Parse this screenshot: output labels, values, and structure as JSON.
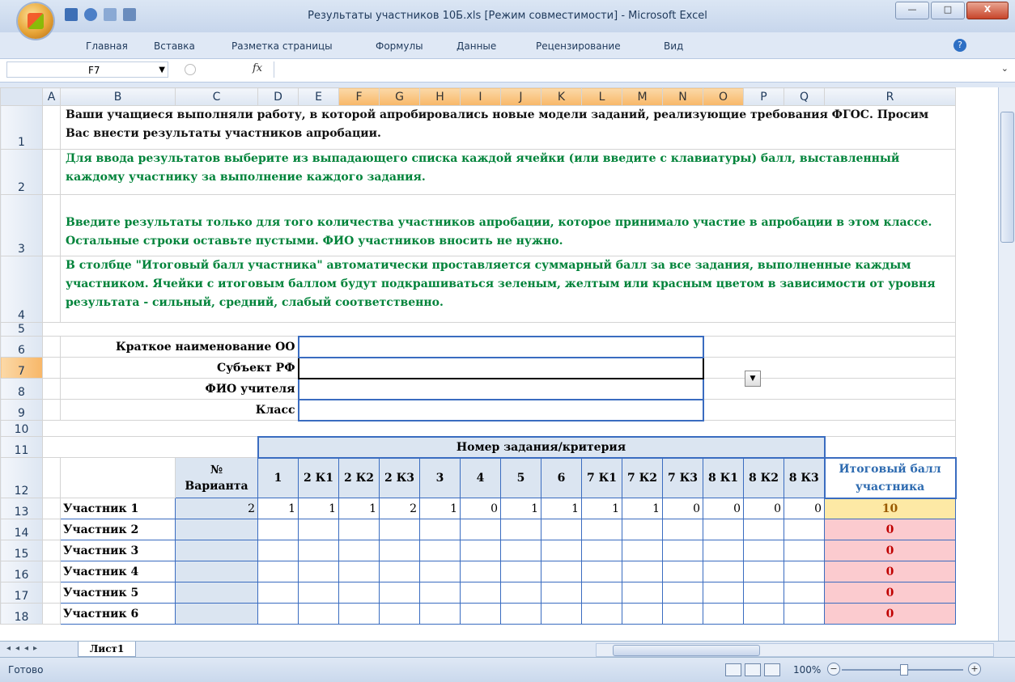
{
  "window": {
    "title": "Результаты участников 10Б.xls  [Режим совместимости] - Microsoft Excel",
    "buttons": {
      "minimize": "—",
      "maximize": "□",
      "close": "X"
    }
  },
  "ribbon": {
    "tabs": [
      "Главная",
      "Вставка",
      "Разметка страницы",
      "Формулы",
      "Данные",
      "Рецензирование",
      "Вид"
    ],
    "help_label": "?"
  },
  "formula_bar": {
    "name_box": "F7",
    "fx_label": "fx",
    "value": ""
  },
  "columns": [
    "A",
    "B",
    "C",
    "D",
    "E",
    "F",
    "G",
    "H",
    "I",
    "J",
    "K",
    "L",
    "M",
    "N",
    "O",
    "P",
    "Q",
    "R"
  ],
  "rows": [
    "1",
    "2",
    "3",
    "4",
    "5",
    "6",
    "7",
    "8",
    "9",
    "10",
    "11",
    "12",
    "13",
    "14",
    "15",
    "16",
    "17",
    "18"
  ],
  "instructions": {
    "r1": "Ваши учащиеся выполняли работу, в которой апробировались новые модели заданий, реализующие требования ФГОС. Просим Вас внести результаты участников апробации.",
    "r2": "Для ввода результатов выберите из выпадающего списка каждой ячейки (или введите с клавиатуры) балл, выставленный каждому участнику за выполнение каждого задания.",
    "r3": "Введите результаты только для того количества участников апробации, которое принимало участие в апробации в этом классе. Остальные строки оставьте пустыми.   ФИО участников вносить не нужно.",
    "r4": "В столбце \"Итоговый балл участника\" автоматически проставляется суммарный балл за все задания, выполненные каждым участником. Ячейки с итоговым баллом будут подкрашиваться зеленым, желтым или красным цветом в зависимости от уровня результата - сильный, средний, слабый соответственно."
  },
  "form": {
    "oo_label": "Краткое наименование ОО",
    "region_label": "Субъект РФ",
    "teacher_label": "ФИО учителя",
    "class_label": "Класс"
  },
  "table": {
    "task_header": "Номер задания/критерия",
    "variant_header": "№ Варианта",
    "total_header": "Итоговый балл участника",
    "task_columns": [
      "1",
      "2 К1",
      "2 К2",
      "2 К3",
      "3",
      "4",
      "5",
      "6",
      "7 К1",
      "7 К2",
      "7 К3",
      "8 К1",
      "8 К2",
      "8 К3"
    ],
    "participants": [
      {
        "name": "Участник 1",
        "variant": "2",
        "scores": [
          "1",
          "1",
          "1",
          "2",
          "1",
          "0",
          "1",
          "1",
          "1",
          "1",
          "0",
          "0",
          "0",
          "0"
        ],
        "total": "10",
        "level": "medium"
      },
      {
        "name": "Участник 2",
        "variant": "",
        "scores": [
          "",
          "",
          "",
          "",
          "",
          "",
          "",
          "",
          "",
          "",
          "",
          "",
          "",
          ""
        ],
        "total": "0",
        "level": "weak"
      },
      {
        "name": "Участник 3",
        "variant": "",
        "scores": [
          "",
          "",
          "",
          "",
          "",
          "",
          "",
          "",
          "",
          "",
          "",
          "",
          "",
          ""
        ],
        "total": "0",
        "level": "weak"
      },
      {
        "name": "Участник 4",
        "variant": "",
        "scores": [
          "",
          "",
          "",
          "",
          "",
          "",
          "",
          "",
          "",
          "",
          "",
          "",
          "",
          ""
        ],
        "total": "0",
        "level": "weak"
      },
      {
        "name": "Участник 5",
        "variant": "",
        "scores": [
          "",
          "",
          "",
          "",
          "",
          "",
          "",
          "",
          "",
          "",
          "",
          "",
          "",
          ""
        ],
        "total": "0",
        "level": "weak"
      },
      {
        "name": "Участник 6",
        "variant": "",
        "scores": [
          "",
          "",
          "",
          "",
          "",
          "",
          "",
          "",
          "",
          "",
          "",
          "",
          "",
          ""
        ],
        "total": "0",
        "level": "weak"
      }
    ]
  },
  "sheet_tabs": [
    "Лист1"
  ],
  "status": {
    "ready": "Готово",
    "zoom": "100%"
  },
  "colors": {
    "accent": "#3a6cc0",
    "green_text": "#00833a",
    "medium": "#fde9a5",
    "weak": "#fbcbcf",
    "header_fill": "#dbe5f1"
  }
}
